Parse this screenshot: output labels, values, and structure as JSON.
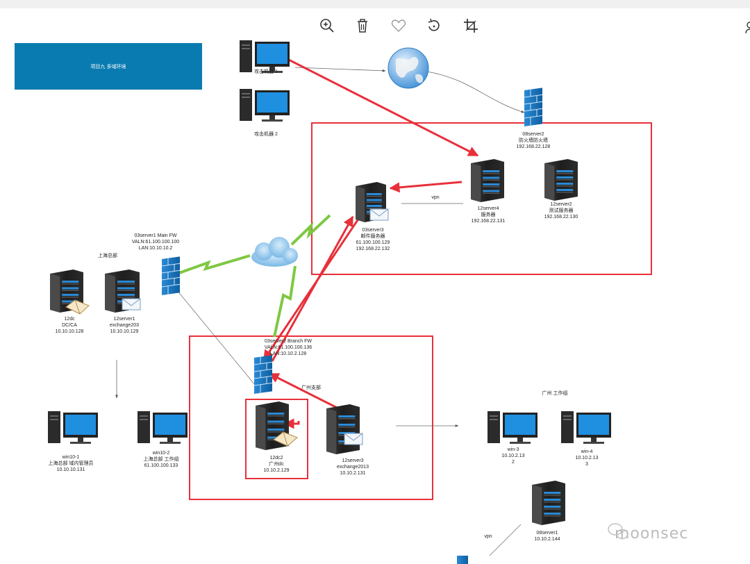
{
  "toolbar": {
    "zoom_in_icon": "zoom-in-icon",
    "delete_icon": "trash-icon",
    "favorite_icon": "heart-icon",
    "rotate_icon": "rotate-icon",
    "crop_icon": "crop-icon"
  },
  "title_box": {
    "text": "项目九 多域环境"
  },
  "nodes": {
    "attacker1": [
      "攻击机器 1"
    ],
    "attacker2": [
      "攻击机器 2"
    ],
    "firewall08": [
      "08server2",
      "防火墙防火墙",
      "192.168.22.128"
    ],
    "server12_4": [
      "12server4",
      "服务器",
      "192.168.22.131"
    ],
    "server12_2": [
      "12server2",
      "测试服务器",
      "192.168.22.130"
    ],
    "server03_3": [
      "03server3",
      "邮件服务器",
      "61.100.100.129",
      "192.168.22.132"
    ],
    "mainfw": [
      "03server1 Main FW",
      "VALN:61.100.100.100",
      "LAN:10.10.10.2"
    ],
    "shanghai": [
      "上海总部"
    ],
    "dc12": [
      "12dc",
      "DC/CA",
      "10.10.10.128"
    ],
    "server12_1": [
      "12server1",
      "exchange203",
      "10.10.10.129"
    ],
    "branchfw": [
      "03server2 Branch FW",
      "VALN:61.100.100.136",
      "LAN:10.10.2.128"
    ],
    "guangzhou_branch": [
      "广州支部"
    ],
    "dc12_2": [
      "12dc2",
      "广州dc",
      "10.10.2.129"
    ],
    "server12_3": [
      "12server3",
      "exchange2013",
      "10.10.2.131"
    ],
    "win10_1": [
      "win10-1",
      "上海总部 域内管理员",
      "10.10.10.131"
    ],
    "win10_2": [
      "win10-2",
      "上海总部 工作组",
      "61.100.100.133"
    ],
    "guangzhou_workgroup": [
      "广州 工作组"
    ],
    "win3": [
      "win-3",
      "10.10.2.13",
      "2"
    ],
    "win4": [
      "win-4",
      "10.10.2.13",
      "3"
    ],
    "server08_1": [
      "08server1",
      "10.10.2.144"
    ],
    "vpn_top": [
      "vpn"
    ],
    "vpn_bottom": [
      "vpn"
    ]
  },
  "colors": {
    "title_box_bg": "#0a7bb0",
    "highlight_red": "#e8303a",
    "lightning_green": "#7ec843",
    "firewall_blue": "#1a7fc8"
  },
  "watermark": "moonsec"
}
